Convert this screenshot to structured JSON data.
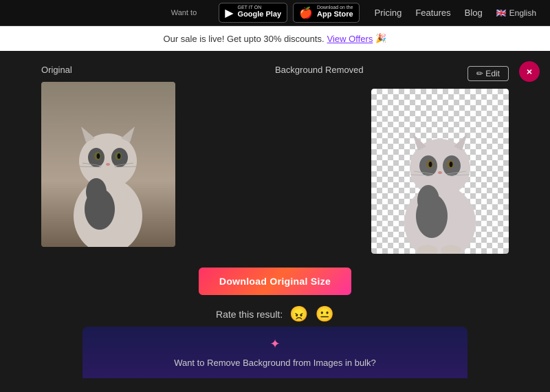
{
  "header": {
    "want_to_text": "Want to",
    "google_play_badge": {
      "top_text": "GET IT ON",
      "main_text": "Google Play",
      "icon": "▶"
    },
    "app_store_badge": {
      "top_text": "Download on the",
      "main_text": "App Store",
      "icon": ""
    },
    "nav": {
      "pricing": "Pricing",
      "features": "Features",
      "blog": "Blog",
      "lang": "English"
    }
  },
  "banner": {
    "text": "Our sale is live! Get upto 30% discounts.",
    "link_text": "View Offers",
    "emoji": "🎉"
  },
  "main": {
    "close_icon": "×",
    "original_label": "Original",
    "removed_label": "Background Removed",
    "edit_button": "✏ Edit",
    "download_button": "Download Original Size",
    "rating_label": "Rate this result:",
    "rating_bad_emoji": "😠",
    "rating_neutral_emoji": "😐",
    "bulk_icon": "✦",
    "bulk_text": "Want to Remove Background from Images in bulk?"
  }
}
